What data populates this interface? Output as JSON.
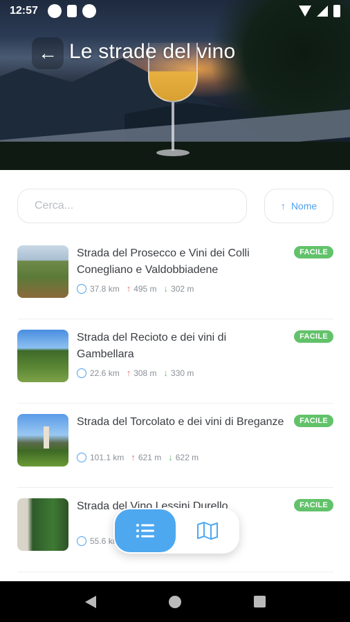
{
  "status_bar": {
    "time": "12:57"
  },
  "header": {
    "title": "Le strade del vino",
    "back_icon": "arrow-left-icon"
  },
  "search": {
    "placeholder": "Cerca..."
  },
  "sort": {
    "label": "Nome",
    "icon": "arrow-up-icon"
  },
  "routes": [
    {
      "name": "Strada del Prosecco e Vini dei Colli Conegliano e Valdobbiadene",
      "difficulty": "FACILE",
      "distance": "37.8 km",
      "ascent": "495 m",
      "descent": "302 m"
    },
    {
      "name": "Strada del Recioto e dei vini di Gambellara",
      "difficulty": "FACILE",
      "distance": "22.6 km",
      "ascent": "308 m",
      "descent": "330 m"
    },
    {
      "name": "Strada del Torcolato e dei vini di Breganze",
      "difficulty": "FACILE",
      "distance": "101.1 km",
      "ascent": "621 m",
      "descent": "622 m"
    },
    {
      "name": "Strada del Vino Lessini Durello",
      "difficulty": "FACILE",
      "distance": "55.6 km",
      "ascent": "",
      "descent": ""
    }
  ],
  "view_toggle": {
    "list_icon": "list-icon",
    "map_icon": "map-icon",
    "active": "list"
  },
  "colors": {
    "accent": "#4da8f0",
    "badge": "#62c26a",
    "ascent": "#e87070",
    "descent": "#5cc070"
  }
}
